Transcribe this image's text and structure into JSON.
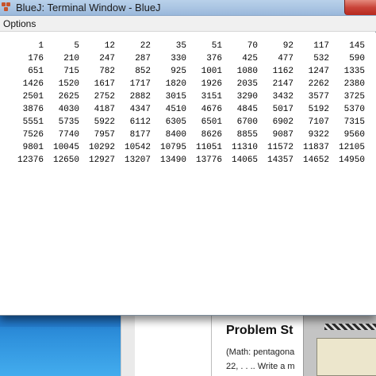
{
  "window": {
    "title": "BlueJ: Terminal Window - BlueJ",
    "menu": [
      "Options"
    ]
  },
  "terminal": {
    "rows": [
      [
        "1",
        "5",
        "12",
        "22",
        "35",
        "51",
        "70",
        "92",
        "117",
        "145"
      ],
      [
        "176",
        "210",
        "247",
        "287",
        "330",
        "376",
        "425",
        "477",
        "532",
        "590"
      ],
      [
        "651",
        "715",
        "782",
        "852",
        "925",
        "1001",
        "1080",
        "1162",
        "1247",
        "1335"
      ],
      [
        "1426",
        "1520",
        "1617",
        "1717",
        "1820",
        "1926",
        "2035",
        "2147",
        "2262",
        "2380"
      ],
      [
        "2501",
        "2625",
        "2752",
        "2882",
        "3015",
        "3151",
        "3290",
        "3432",
        "3577",
        "3725"
      ],
      [
        "3876",
        "4030",
        "4187",
        "4347",
        "4510",
        "4676",
        "4845",
        "5017",
        "5192",
        "5370"
      ],
      [
        "5551",
        "5735",
        "5922",
        "6112",
        "6305",
        "6501",
        "6700",
        "6902",
        "7107",
        "7315"
      ],
      [
        "7526",
        "7740",
        "7957",
        "8177",
        "8400",
        "8626",
        "8855",
        "9087",
        "9322",
        "9560"
      ],
      [
        "9801",
        "10045",
        "10292",
        "10542",
        "10795",
        "11051",
        "11310",
        "11572",
        "11837",
        "12105"
      ],
      [
        "12376",
        "12650",
        "12927",
        "13207",
        "13490",
        "13776",
        "14065",
        "14357",
        "14652",
        "14950"
      ]
    ]
  },
  "background_document": {
    "heading": "Problem St",
    "lines": [
      "(Math: pentagona",
      "22, . . .. Write a m"
    ]
  },
  "colors": {
    "titlebar": "#a9c4e2",
    "close_button": "#c9443a",
    "taskbar_blue": "#2a8ad8"
  }
}
